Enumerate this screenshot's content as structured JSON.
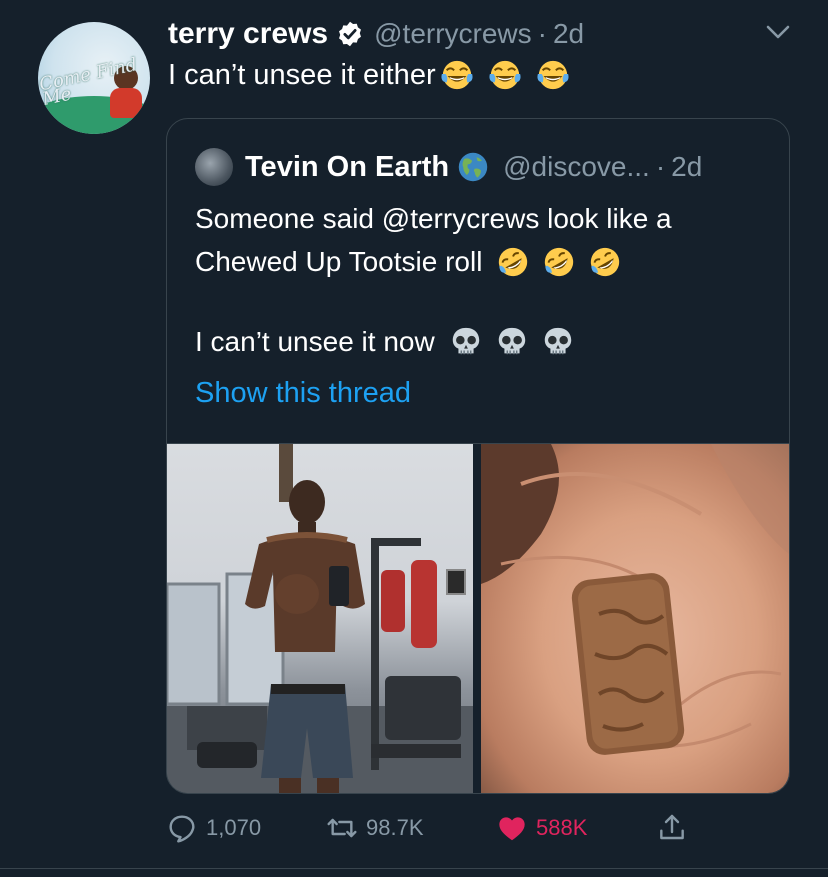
{
  "tweet": {
    "author_name": "terry crews",
    "author_handle": "@terrycrews",
    "separator": "·",
    "age": "2d",
    "text": "I can’t unsee it either",
    "avatar_text": "Come Find Me",
    "emoji": [
      "face-with-tears-of-joy",
      "face-with-tears-of-joy",
      "face-with-tears-of-joy"
    ]
  },
  "quote": {
    "author_name": "Tevin On Earth",
    "author_handle": "@discove...",
    "separator": "·",
    "age": "2d",
    "line1": "Someone said @terrycrews look like a",
    "line2": "Chewed Up Tootsie roll",
    "line2_emoji": [
      "rolling-on-floor-laughing",
      "rolling-on-floor-laughing",
      "rolling-on-floor-laughing"
    ],
    "line3": "I can’t unsee it now",
    "line3_emoji": [
      "skull",
      "skull",
      "skull"
    ],
    "show_thread": "Show this thread"
  },
  "actions": {
    "replies": "1,070",
    "retweets": "98.7K",
    "likes": "588K"
  },
  "colors": {
    "background": "#15202b",
    "secondary_text": "#8899a6",
    "link": "#1da1f2",
    "like": "#e0245e",
    "border": "#38444d"
  }
}
